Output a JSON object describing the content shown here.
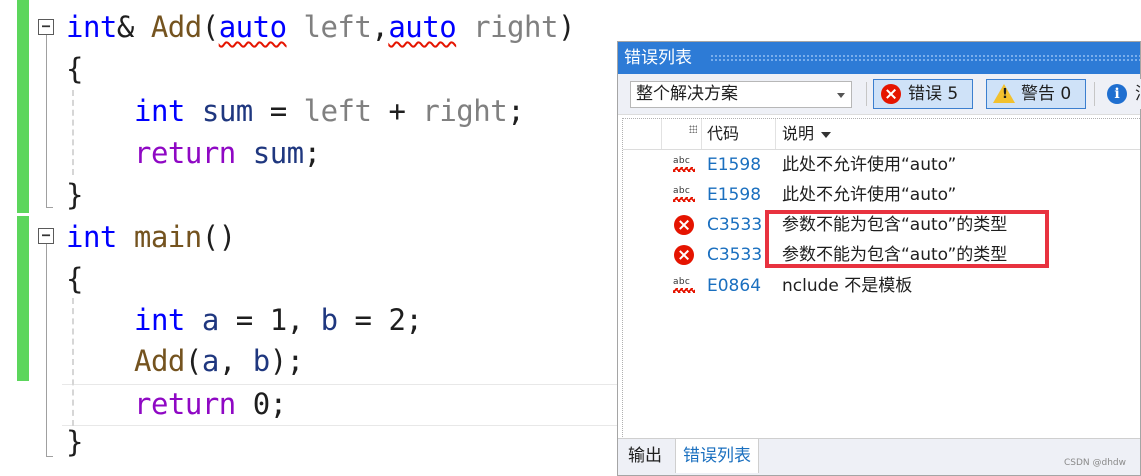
{
  "editor": {
    "lines": {
      "l1": {
        "kw": "int",
        "amp": "&",
        "fn": "Add",
        "p1": "(",
        "a1": "auto",
        "sp1": " ",
        "n1": "left",
        "c1": ",",
        "a2": "auto",
        "sp2": " ",
        "n2": "right",
        "p2": ")"
      },
      "l2": {
        "text": "{"
      },
      "l3": {
        "kw": "int",
        "sp": " ",
        "v": "sum",
        "eq": " = ",
        "a": "left",
        "plus": " + ",
        "b": "right",
        "end": ";"
      },
      "l4": {
        "kw": "return",
        "sp": " ",
        "v": "sum",
        "end": ";"
      },
      "l5": {
        "text": "}"
      },
      "l6": {
        "kw": "int",
        "sp": " ",
        "fn": "main",
        "p": "()"
      },
      "l7": {
        "text": "{"
      },
      "l8": {
        "kw": "int",
        "sp": " ",
        "a": "a",
        "eq1": " = 1, ",
        "b": "b",
        "eq2": " = 2;"
      },
      "l9": {
        "fn": "Add",
        "p1": "(",
        "a": "a",
        "c": ", ",
        "b": "b",
        "p2": ");"
      },
      "l10": {
        "kw": "return",
        "rest": " 0;"
      },
      "l11": {
        "text": "}"
      }
    },
    "fold_symbol": "−"
  },
  "error_list": {
    "title": "错误列表",
    "scope_value": "整个解决方案",
    "errors_label": "错误 5",
    "warnings_label": "警告 0",
    "messages_label_partial": "消",
    "columns": {
      "code": "代码",
      "description": "说明"
    },
    "rows": [
      {
        "icon": "spell-squiggle-icon",
        "code": "E1598",
        "description": "此处不允许使用“auto”"
      },
      {
        "icon": "spell-squiggle-icon",
        "code": "E1598",
        "description": "此处不允许使用“auto”"
      },
      {
        "icon": "error-icon",
        "code": "C3533",
        "description": "参数不能为包含“auto”的类型"
      },
      {
        "icon": "error-icon",
        "code": "C3533",
        "description": "参数不能为包含“auto”的类型"
      },
      {
        "icon": "spell-squiggle-icon",
        "code": "E0864",
        "description": "nclude 不是模板"
      }
    ],
    "tabs": {
      "output": "输出",
      "error_list": "错误列表"
    },
    "abc_text": "abc",
    "warning_glyph": "!",
    "info_glyph": "i"
  },
  "watermark": "CSDN @dhdw",
  "colors": {
    "accent": "#2d7bd6",
    "error": "#e51400",
    "keyword": "#0000ff",
    "change_bar": "#5cd65c",
    "highlight_box": "#e8323f"
  }
}
